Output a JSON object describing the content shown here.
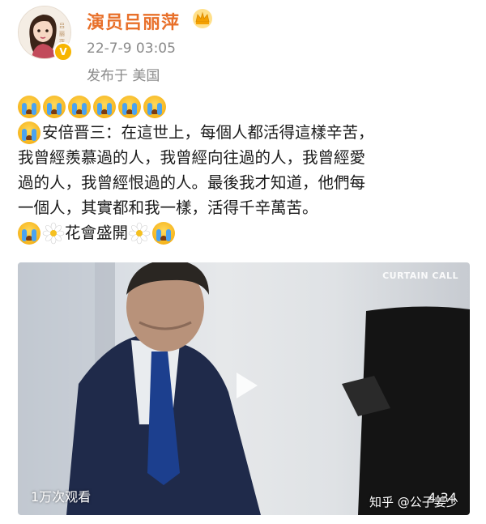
{
  "header": {
    "username": "演员吕丽萍",
    "crown_icon": "crown-icon",
    "verified_icon": "verified-v-icon",
    "post_time": "22-7-9 03:05",
    "location": "发布于 美国"
  },
  "post": {
    "emoji_row": [
      "cry-emoji",
      "cry-emoji",
      "cry-emoji",
      "cry-emoji",
      "cry-emoji",
      "cry-emoji"
    ],
    "lines": [
      "安倍晋三：在這世上，每個人都活得這樣辛苦，",
      "我曾經羨慕過的人，我曾經向往過的人，我曾經愛",
      "過的人，我曾經恨過的人。最後我才知道，他們每",
      "一個人，其實都和我一樣，活得千辛萬苦。",
      "花會盛開"
    ]
  },
  "video": {
    "overlay_label": "CURTAIN CALL",
    "play_icon": "play-icon",
    "view_count": "1万次观看",
    "duration": "4:34"
  },
  "watermark": {
    "text": "知乎 @公子姜少"
  },
  "colors": {
    "username": "#e8702a",
    "meta_text": "#8a8a8a",
    "verified": "#f7b500"
  }
}
